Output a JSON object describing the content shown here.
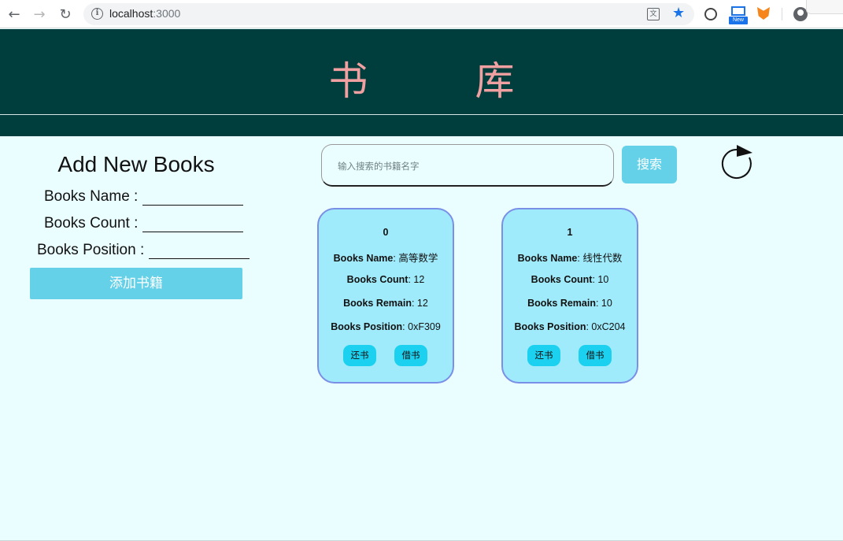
{
  "browser": {
    "url_host": "localhost",
    "url_port": ":3000",
    "extension_badge": "New"
  },
  "header": {
    "title": "书 库"
  },
  "add_form": {
    "title": "Add New Books",
    "name_label": "Books Name :",
    "count_label": "Books Count :",
    "position_label": "Books Position :",
    "submit_label": "添加书籍"
  },
  "search": {
    "placeholder": "输入搜索的书籍名字",
    "button_label": "搜索"
  },
  "books": [
    {
      "id": "0",
      "name_key": "Books Name",
      "name": ": 高等数学",
      "count_key": "Books Count",
      "count": ": 12",
      "remain_key": "Books Remain",
      "remain": ": 12",
      "position_key": "Books Position",
      "position": ": 0xF309",
      "return_label": "还书",
      "borrow_label": "借书"
    },
    {
      "id": "1",
      "name_key": "Books Name",
      "name": ": 线性代数",
      "count_key": "Books Count",
      "count": ": 10",
      "remain_key": "Books Remain",
      "remain": ": 10",
      "position_key": "Books Position",
      "position": ": 0xC204",
      "return_label": "还书",
      "borrow_label": "借书"
    }
  ],
  "colors": {
    "header_bg": "#003d3d",
    "title_color": "#f0a0a0",
    "page_bg": "#ebfeff",
    "button_bg": "#64d1e8",
    "card_bg": "#a0ebfb",
    "card_border": "#7a8fe6",
    "card_button": "#1cd1f0"
  },
  "icons": {
    "back": "arrow-left-icon",
    "forward": "arrow-right-icon",
    "reload": "reload-icon",
    "info": "info-icon",
    "translate": "translate-icon",
    "bookmark": "star-icon",
    "refresh": "refresh-icon"
  }
}
